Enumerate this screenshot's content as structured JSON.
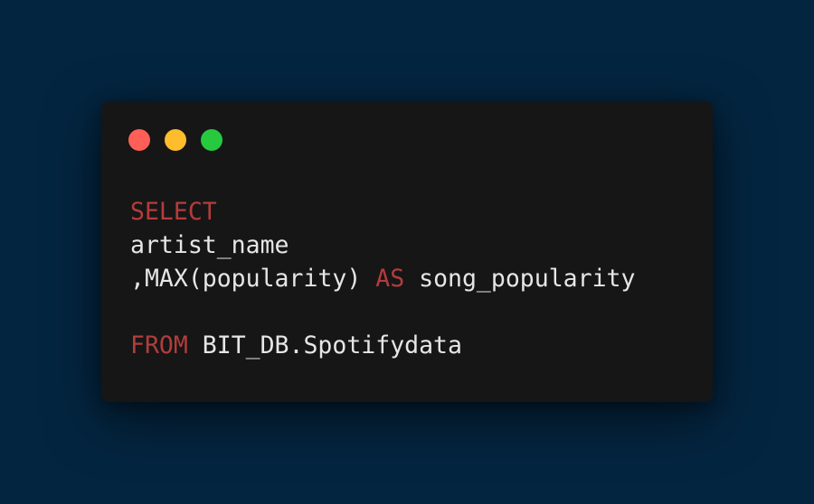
{
  "colors": {
    "background": "#042540",
    "window": "#161616",
    "close": "#ff5f56",
    "minimize": "#ffbd2e",
    "maximize": "#27c93f",
    "keyword": "#b43c3c",
    "text": "#e6e6e6"
  },
  "window_controls": [
    {
      "name": "close",
      "icon": "close-dot-icon"
    },
    {
      "name": "minimize",
      "icon": "minimize-dot-icon"
    },
    {
      "name": "maximize",
      "icon": "maximize-dot-icon"
    }
  ],
  "code": {
    "lines": [
      {
        "tokens": [
          {
            "text": "SELECT",
            "kind": "keyword"
          }
        ]
      },
      {
        "tokens": [
          {
            "text": "artist_name",
            "kind": "text"
          }
        ]
      },
      {
        "tokens": [
          {
            "text": ",MAX(popularity) ",
            "kind": "text"
          },
          {
            "text": "AS",
            "kind": "keyword"
          },
          {
            "text": " song_popularity",
            "kind": "text"
          }
        ]
      },
      {
        "tokens": []
      },
      {
        "tokens": [
          {
            "text": "FROM",
            "kind": "keyword"
          },
          {
            "text": " BIT_DB.Spotifydata",
            "kind": "text"
          }
        ]
      }
    ]
  }
}
